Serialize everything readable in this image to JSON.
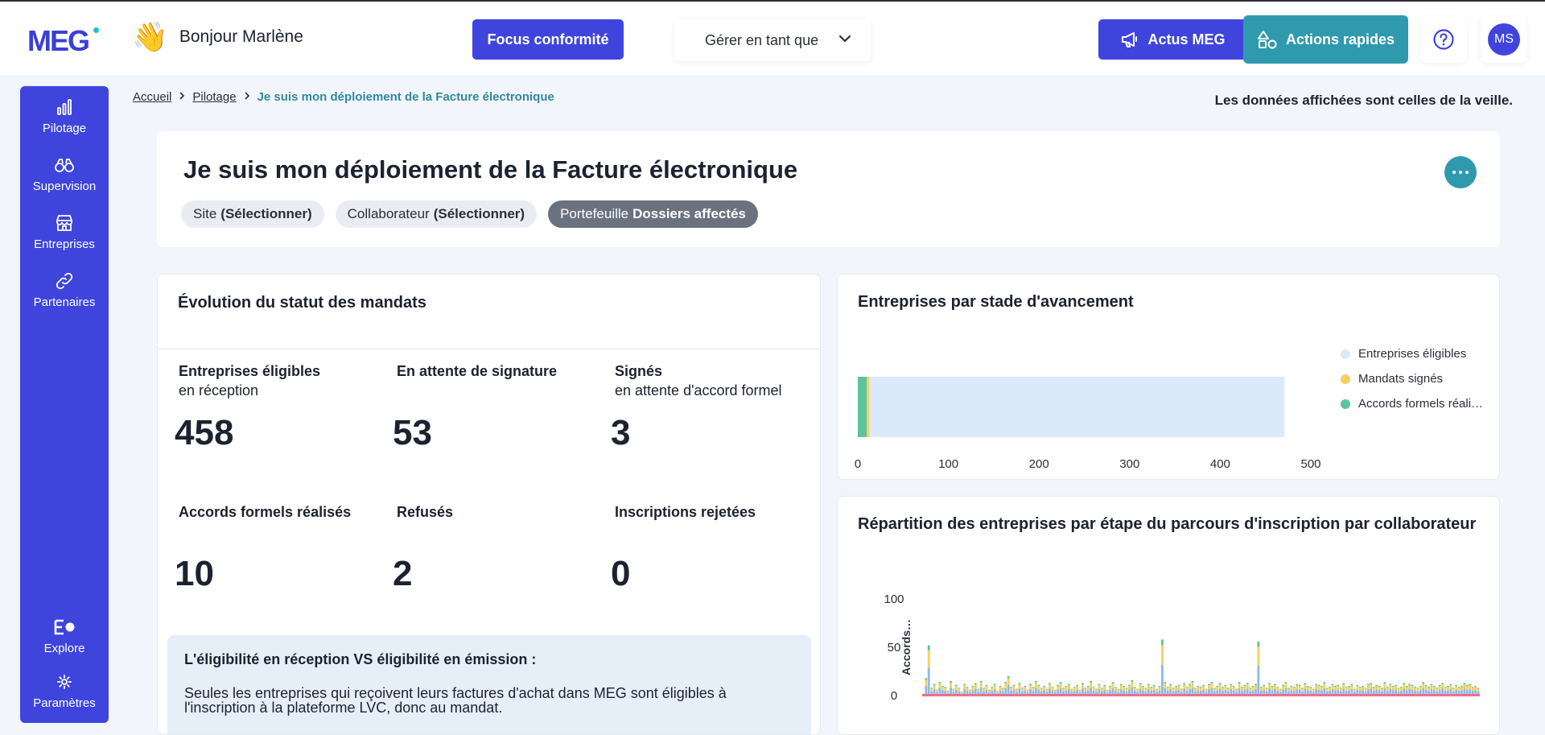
{
  "topbar": {
    "logo": "MEG",
    "greeting": "Bonjour Marlène",
    "focus_button": "Focus conformité",
    "manage_label": "Gérer en tant que",
    "actus_button": "Actus MEG",
    "quick_actions_button": "Actions rapides",
    "avatar_initials": "MS"
  },
  "sidebar": {
    "items": [
      {
        "label": "Pilotage",
        "icon": "bar-chart-icon"
      },
      {
        "label": "Supervision",
        "icon": "binoculars-icon"
      },
      {
        "label": "Entreprises",
        "icon": "store-icon"
      },
      {
        "label": "Partenaires",
        "icon": "link-icon"
      }
    ],
    "bottom_items": [
      {
        "label": "Explore",
        "icon": "explore-icon"
      },
      {
        "label": "Paramètres",
        "icon": "gear-icon"
      }
    ]
  },
  "breadcrumb": {
    "items": [
      "Accueil",
      "Pilotage"
    ],
    "current": "Je suis mon déploiement de la Facture électronique"
  },
  "veille_notice": "Les données affichées sont celles de la veille.",
  "header": {
    "title": "Je suis mon déploiement de la Facture électronique",
    "filters": [
      {
        "label": "Site",
        "value": "(Sélectionner)"
      },
      {
        "label": "Collaborateur",
        "value": "(Sélectionner)"
      },
      {
        "label": "Portefeuille",
        "value": "Dossiers affectés"
      }
    ]
  },
  "mandats": {
    "title": "Évolution du statut des mandats",
    "stats": [
      {
        "label": "Entreprises éligibles",
        "sub": "en réception",
        "value": "458"
      },
      {
        "label": "En attente de signature",
        "sub": "",
        "value": "53"
      },
      {
        "label": "Signés",
        "sub": "en attente d'accord formel",
        "value": "3"
      },
      {
        "label": "Accords formels réalisés",
        "sub": "",
        "value": "10"
      },
      {
        "label": "Refusés",
        "sub": "",
        "value": "2"
      },
      {
        "label": "Inscriptions rejetées",
        "sub": "",
        "value": "0"
      }
    ],
    "info_title": "L'éligibilité en réception VS éligibilité en émission :",
    "info_text": "Seules les entreprises qui reçoivent leurs factures d'achat dans MEG sont éligibles à l'inscription à la plateforme LVC, donc au mandat."
  },
  "colors": {
    "primary": "#3f45dc",
    "teal": "#2f9aae",
    "eligible": "#dce9fb",
    "signed": "#f6cf5f",
    "accords": "#5cc49a"
  },
  "chart_data": [
    {
      "type": "bar",
      "title": "Entreprises par stade d'avancement",
      "orientation": "horizontal",
      "stacked": true,
      "series": [
        {
          "name": "Entreprises éligibles",
          "values": [
            458
          ]
        },
        {
          "name": "Mandats signés",
          "values": [
            3
          ]
        },
        {
          "name": "Accords formels réali…",
          "values": [
            10
          ]
        }
      ],
      "xlim": [
        0,
        500
      ],
      "xticks": [
        "0",
        "100",
        "200",
        "300",
        "400",
        "500"
      ],
      "legend": "right"
    },
    {
      "type": "bar",
      "title": "Répartition des entreprises par étape du parcours d'inscription par collaborateur",
      "ylabel": "Accords…",
      "ylim": [
        0,
        100
      ],
      "yticks": [
        "100",
        "50",
        "0"
      ],
      "stacked": true,
      "values": [
        2,
        18,
        52,
        8,
        12,
        6,
        14,
        10,
        9,
        5,
        15,
        7,
        11,
        8,
        4,
        12,
        9,
        6,
        10,
        13,
        7,
        15,
        8,
        11,
        6,
        9,
        12,
        5,
        10,
        8,
        14,
        20,
        9,
        11,
        7,
        13,
        8,
        10,
        6,
        12,
        9,
        15,
        11,
        8,
        10,
        7,
        13,
        9,
        6,
        11,
        14,
        8,
        10,
        12,
        7,
        9,
        11,
        6,
        13,
        8,
        10,
        15,
        9,
        7,
        12,
        8,
        11,
        6,
        10,
        14,
        9,
        7,
        12,
        10,
        8,
        11,
        16,
        9,
        7,
        13,
        10,
        8,
        12,
        9,
        11,
        7,
        10,
        58,
        14,
        9,
        12,
        8,
        10,
        11,
        7,
        13,
        9,
        12,
        15,
        8,
        10,
        9,
        11,
        7,
        12,
        14,
        8,
        10,
        13,
        9,
        11,
        8,
        12,
        10,
        7,
        14,
        9,
        11,
        13,
        8,
        10,
        12,
        56,
        9,
        11,
        8,
        13,
        10,
        12,
        9,
        7,
        11,
        14,
        8,
        10,
        9,
        12,
        11,
        8,
        13,
        10,
        9,
        7,
        12,
        11,
        10,
        14,
        8,
        9,
        12,
        10,
        11,
        8,
        13,
        9,
        10,
        12,
        7,
        11,
        9,
        10,
        8,
        12,
        13,
        9,
        11,
        10,
        8,
        14,
        9,
        12,
        10,
        11,
        8,
        9,
        13,
        10,
        12,
        11,
        9,
        8,
        10,
        14,
        11,
        9,
        12,
        10,
        8,
        11,
        13,
        9,
        10,
        12,
        8,
        11,
        9,
        10,
        13,
        11,
        12,
        9,
        10,
        8
      ]
    }
  ]
}
